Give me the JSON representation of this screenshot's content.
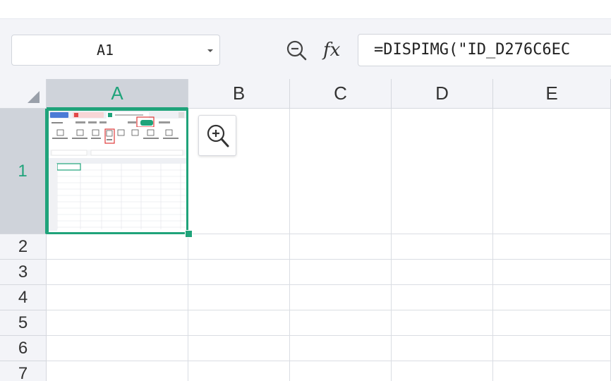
{
  "name_box": {
    "value": "A1"
  },
  "formula_bar": {
    "fx_label": "fx",
    "formula": "=DISPIMG(\"ID_D276C6EC"
  },
  "columns": [
    "A",
    "B",
    "C",
    "D",
    "E"
  ],
  "rows": [
    "1",
    "2",
    "3",
    "4",
    "5",
    "6",
    "7"
  ],
  "selection": {
    "cell": "A1",
    "column": "A",
    "row": "1"
  },
  "colors": {
    "accent": "#1fa37a",
    "header_bg": "#f3f4f8",
    "active_header_bg": "#cfd3da",
    "gridline": "#dadde3"
  },
  "icons": [
    "chevron-down-icon",
    "zoom-out-icon",
    "zoom-in-icon",
    "select-all-triangle-icon"
  ]
}
